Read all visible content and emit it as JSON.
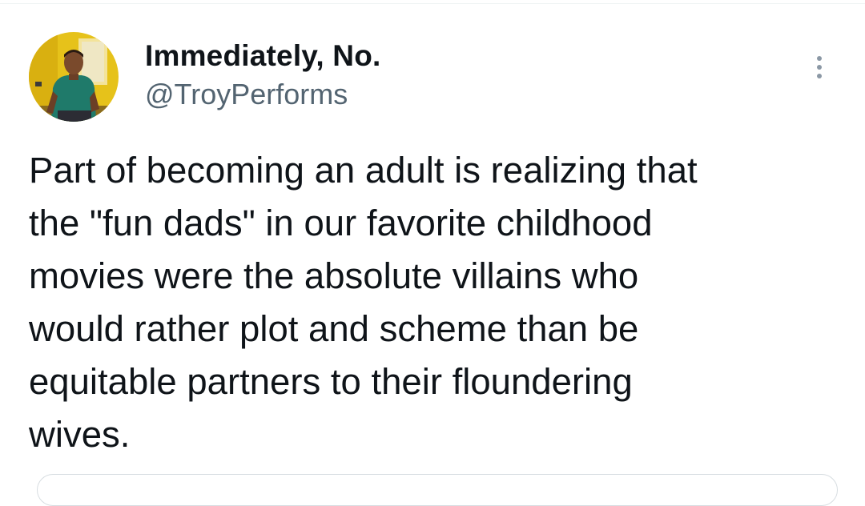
{
  "tweet": {
    "author": {
      "display_name": "Immediately, No.",
      "handle": "@TroyPerforms",
      "avatar_icon": "profile-photo"
    },
    "more_icon": "more-vertical-icon",
    "text": "Part of becoming an adult is realizing that\nthe \"fun dads\" in our favorite childhood\nmovies were the absolute villains who\nwould rather plot and scheme than be\nequitable partners to their floundering\nwives."
  },
  "colors": {
    "text": "#0f1419",
    "secondary_text": "#536471",
    "icon": "#8b98a5",
    "avatar_background": "#e6c21a",
    "shirt": "#1f7a6a"
  }
}
